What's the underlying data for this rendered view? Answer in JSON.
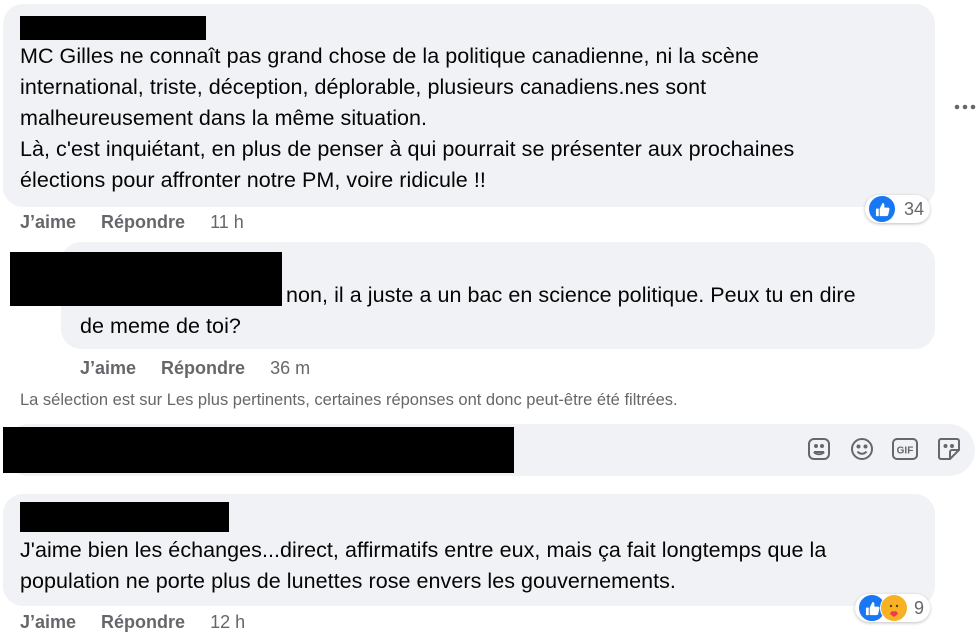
{
  "comments": [
    {
      "text": "MC Gilles ne connaît pas grand chose de la politique canadienne, ni la scène\ninternational, triste, déception, déplorable, plusieurs canadiens.nes sont\nmalheureusement dans la même situation.\nLà, c'est inquiétant, en plus de penser à qui pourrait se présenter aux prochaines\nélections pour affronter notre PM, voire ridicule !!",
      "like_label": "J’aime",
      "reply_label": "Répondre",
      "time": "11 h",
      "reaction_count": "34",
      "reactions": [
        "like-icon"
      ]
    },
    {
      "text": "non, il a juste a un bac en science politique. Peux tu en dire\nde meme de toi?",
      "like_label": "J’aime",
      "reply_label": "Répondre",
      "time": "36 m"
    },
    {
      "text": "J'aime bien les échanges...direct, affirmatifs entre eux, mais ça fait longtemps que la\npopulation ne porte plus de lunettes rose envers les gouvernements.",
      "like_label": "J’aime",
      "reply_label": "Répondre",
      "time": "12 h",
      "reaction_count": "9",
      "reactions": [
        "like-icon",
        "care-icon"
      ]
    }
  ],
  "filter_notice": "La sélection est sur Les plus pertinents, certaines réponses ont donc peut-être été filtrées.",
  "composer": {
    "icons": [
      "avatar-sticker-icon",
      "emoji-icon",
      "gif-icon",
      "sticker-icon"
    ]
  },
  "colors": {
    "bubble": "#f0f2f5",
    "secondary_text": "#65676b",
    "like_blue": "#1877f2"
  }
}
